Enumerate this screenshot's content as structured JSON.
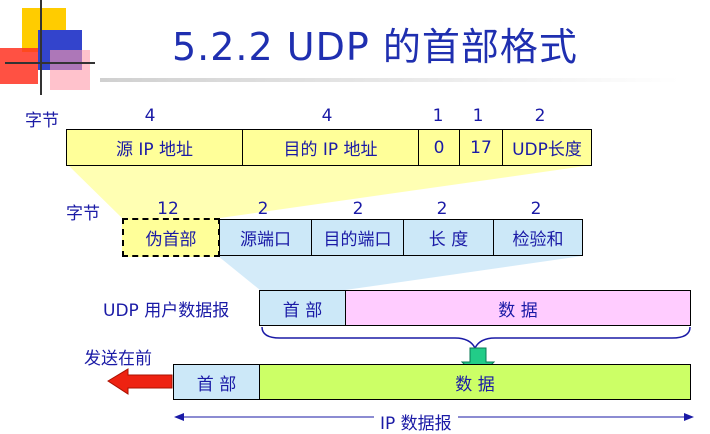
{
  "title": "5.2.2 UDP 的首部格式",
  "row1": {
    "unit_label": "字节",
    "sizes": [
      "4",
      "4",
      "1",
      "1",
      "2"
    ],
    "fields": [
      "源 IP 地址",
      "目的 IP 地址",
      "0",
      "17",
      "UDP长度"
    ]
  },
  "row2": {
    "unit_label": "字节",
    "sizes": [
      "12",
      "2",
      "2",
      "2",
      "2"
    ],
    "fields": [
      "伪首部",
      "源端口",
      "目的端口",
      "长 度",
      "检验和"
    ]
  },
  "row3": {
    "label": "UDP 用户数据报",
    "header": "首 部",
    "data": "数        据"
  },
  "row4": {
    "send_first_label": "发送在前",
    "header": "首 部",
    "data": "数        据",
    "span_label": "IP 数据报"
  },
  "colors": {
    "title": "#1f2fb0",
    "yellow": "#ffff99",
    "blue": "#cce8f8",
    "pink": "#ffccff",
    "green": "#ccff66",
    "red_arrow": "#ee2211",
    "green_arrow": "#22cc88"
  }
}
